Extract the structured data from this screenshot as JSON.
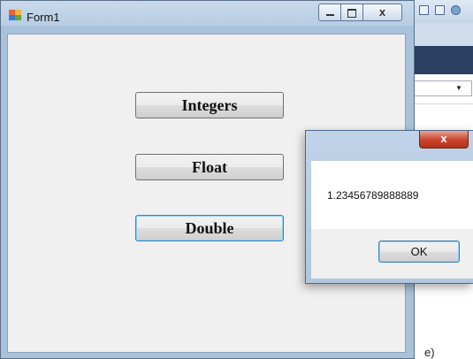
{
  "form": {
    "title": "Form1",
    "buttons": {
      "integers": "Integers",
      "float": "Float",
      "double": "Double"
    },
    "caption_icons": [
      "minimize-icon",
      "maximize-icon",
      "close-icon"
    ]
  },
  "message_box": {
    "text": "1.23456789888889",
    "ok_label": "OK",
    "close_glyph": "x"
  },
  "background": {
    "partial_text": "e)"
  },
  "colors": {
    "client_bg": "#f0f0f0",
    "frame": "#b7cde4",
    "focus_border": "#3c7fb1",
    "close_red": "#c8432a"
  }
}
